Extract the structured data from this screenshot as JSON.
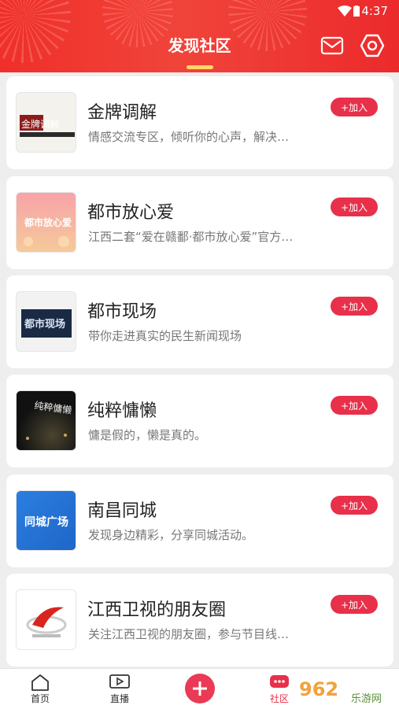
{
  "status_bar": {
    "time": "4:37"
  },
  "header": {
    "title": "发现社区"
  },
  "join_label": "+加入",
  "communities": [
    {
      "title": "金牌调解",
      "description": "情感交流专区，倾听你的心声，解决…",
      "thumb_icon": "golden-mediation-logo",
      "thumb_text": "金牌调解"
    },
    {
      "title": "都市放心爱",
      "description": "江西二套“爱在赣鄱·都市放心爱”官方…",
      "thumb_icon": "urban-love-poster",
      "thumb_text": "都市放心爱"
    },
    {
      "title": "都市现场",
      "description": "带你走进真实的民生新闻现场",
      "thumb_icon": "urban-scene-logo",
      "thumb_text": "都市现场"
    },
    {
      "title": "纯粹慵懒",
      "description": "慵是假的，懒是真的。",
      "thumb_icon": "pure-lazy-poster",
      "thumb_text": "纯粹慵懒"
    },
    {
      "title": "南昌同城",
      "description": "发现身边精彩，分享同城活动。",
      "thumb_icon": "nanchang-local-logo",
      "thumb_text": "同城广场"
    },
    {
      "title": "江西卫视的朋友圈",
      "description": "关注江西卫视的朋友圈，参与节目线…",
      "thumb_icon": "jiangxi-tv-logo",
      "thumb_text": ""
    }
  ],
  "tabbar": {
    "home": "首页",
    "live": "直播",
    "community": "社区"
  },
  "watermark": {
    "text": "962",
    "site": "乐游网"
  },
  "colors": {
    "header_red": "#ef2f2a",
    "accent": "#e8304a",
    "underline": "#ffd666"
  }
}
